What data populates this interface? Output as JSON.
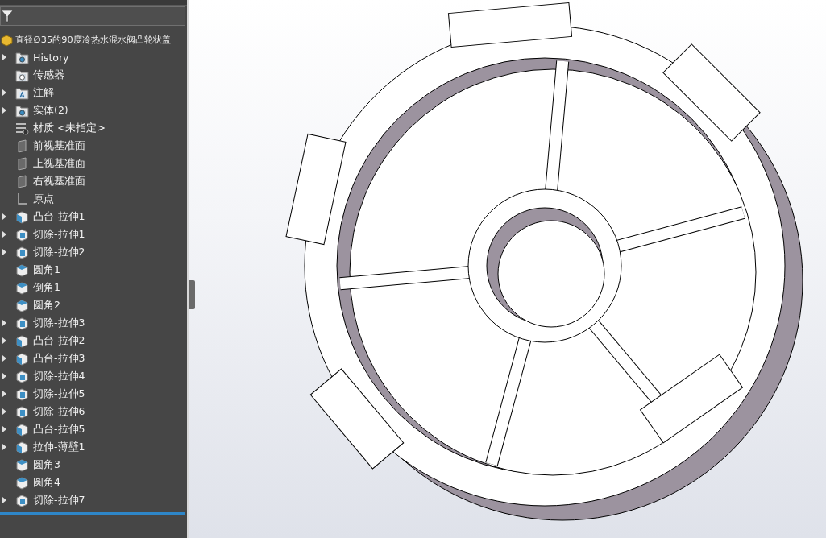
{
  "feature_tree": {
    "root": "直径∅35的90度冷热水混水阀凸轮状盖",
    "items": [
      {
        "kind": "history",
        "label": "History",
        "expandable": true
      },
      {
        "kind": "sensor",
        "label": "传感器",
        "expandable": false
      },
      {
        "kind": "annotation",
        "label": "注解",
        "expandable": true
      },
      {
        "kind": "bodies",
        "label": "实体(2)",
        "expandable": true
      },
      {
        "kind": "material",
        "label": "材质 <未指定>",
        "expandable": false
      },
      {
        "kind": "plane",
        "label": "前视基准面",
        "expandable": false
      },
      {
        "kind": "plane",
        "label": "上视基准面",
        "expandable": false
      },
      {
        "kind": "plane",
        "label": "右视基准面",
        "expandable": false
      },
      {
        "kind": "origin",
        "label": "原点",
        "expandable": false
      },
      {
        "kind": "boss",
        "label": "凸台-拉伸1",
        "expandable": true
      },
      {
        "kind": "cut",
        "label": "切除-拉伸1",
        "expandable": true
      },
      {
        "kind": "cut",
        "label": "切除-拉伸2",
        "expandable": true
      },
      {
        "kind": "fillet",
        "label": "圆角1",
        "expandable": false
      },
      {
        "kind": "chamfer",
        "label": "倒角1",
        "expandable": false
      },
      {
        "kind": "fillet",
        "label": "圆角2",
        "expandable": false
      },
      {
        "kind": "cut",
        "label": "切除-拉伸3",
        "expandable": true
      },
      {
        "kind": "boss",
        "label": "凸台-拉伸2",
        "expandable": true
      },
      {
        "kind": "boss",
        "label": "凸台-拉伸3",
        "expandable": true
      },
      {
        "kind": "cut",
        "label": "切除-拉伸4",
        "expandable": true
      },
      {
        "kind": "cut",
        "label": "切除-拉伸5",
        "expandable": true
      },
      {
        "kind": "cut",
        "label": "切除-拉伸6",
        "expandable": true
      },
      {
        "kind": "boss",
        "label": "凸台-拉伸5",
        "expandable": true
      },
      {
        "kind": "boss",
        "label": "拉伸-薄壁1",
        "expandable": true
      },
      {
        "kind": "fillet",
        "label": "圆角3",
        "expandable": false
      },
      {
        "kind": "fillet",
        "label": "圆角4",
        "expandable": false
      },
      {
        "kind": "cut",
        "label": "切除-拉伸7",
        "expandable": true
      }
    ]
  }
}
